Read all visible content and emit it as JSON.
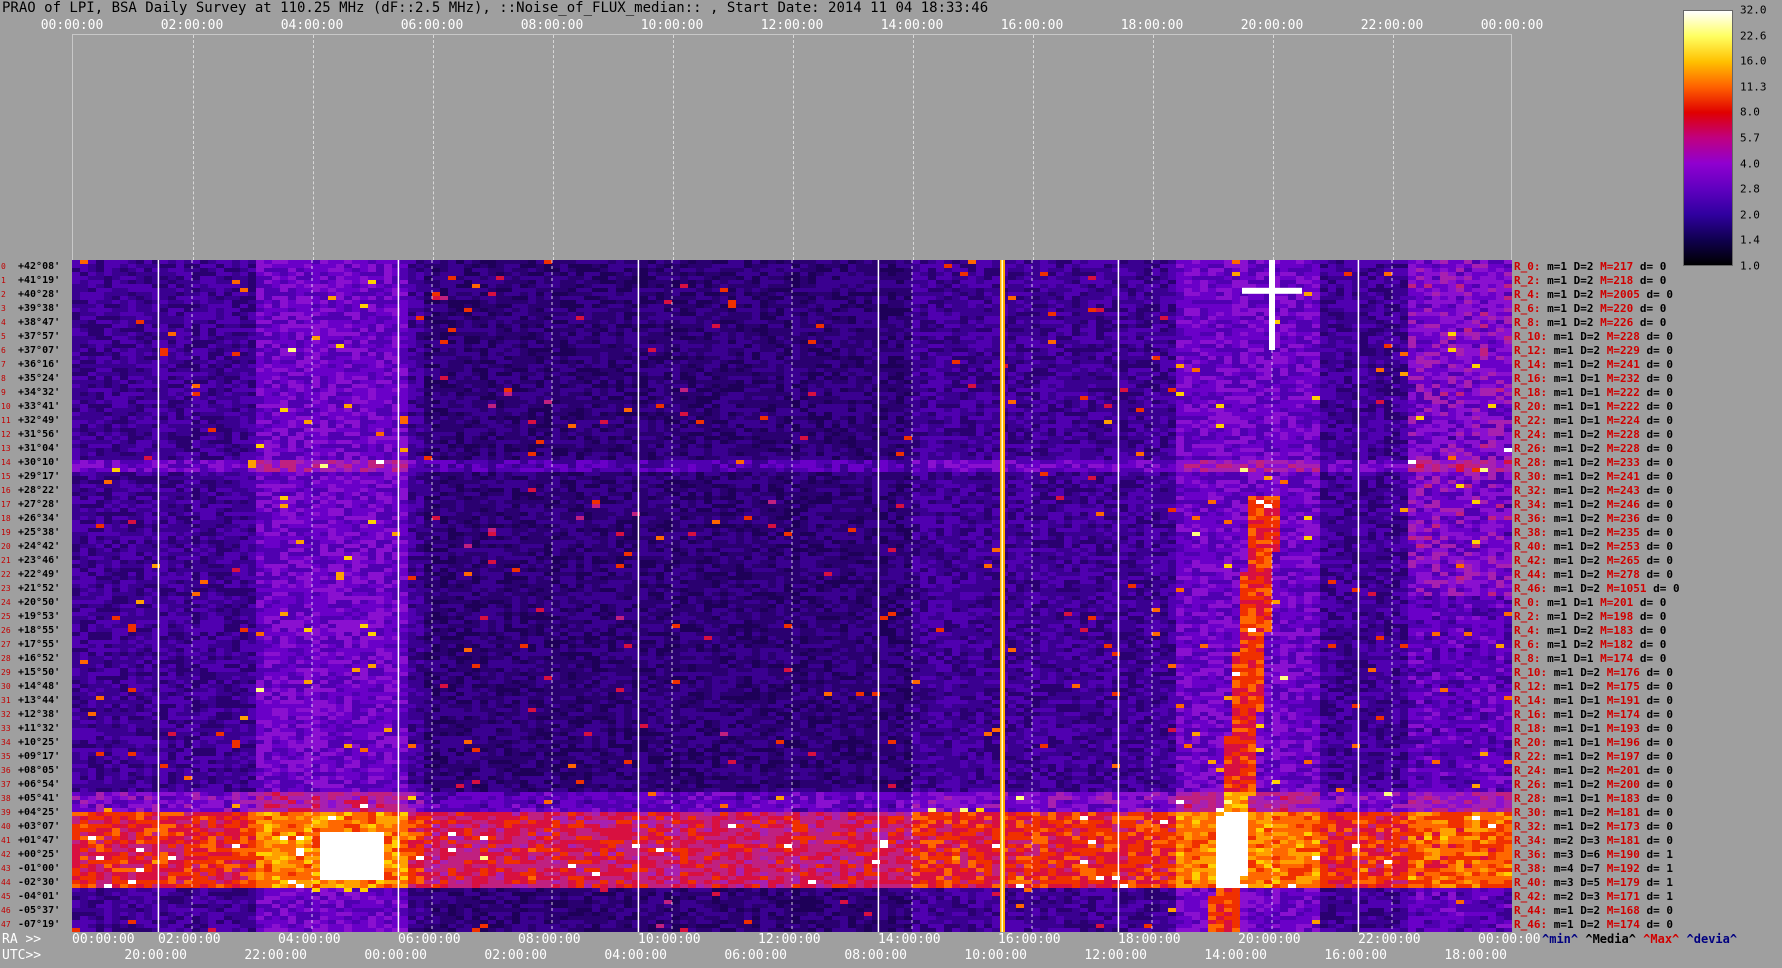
{
  "title": "PRAO of LPI, BSA Daily Survey at 110.25 MHz (dF::2.5 MHz), ::Noise_of_FLUX_median:: , Start Date: 2014 11 04 18:33:46",
  "top_axis_labels": [
    "00:00:00",
    "02:00:00",
    "04:00:00",
    "06:00:00",
    "08:00:00",
    "10:00:00",
    "12:00:00",
    "14:00:00",
    "16:00:00",
    "18:00:00",
    "20:00:00",
    "22:00:00",
    "00:00:00"
  ],
  "bottom": {
    "ra_prefix": "RA >>",
    "utc_prefix": "UTC>>",
    "ra_labels": [
      "00:00:00",
      "02:00:00",
      "04:00:00",
      "06:00:00",
      "08:00:00",
      "10:00:00",
      "12:00:00",
      "14:00:00",
      "16:00:00",
      "18:00:00",
      "20:00:00",
      "22:00:00",
      "00:00:00"
    ],
    "utc_labels": [
      "20:00:00",
      "22:00:00",
      "00:00:00",
      "02:00:00",
      "04:00:00",
      "06:00:00",
      "08:00:00",
      "10:00:00",
      "12:00:00",
      "14:00:00",
      "16:00:00",
      "18:00:00"
    ],
    "legend_keys": [
      {
        "text": "^min^",
        "color": "#000080"
      },
      {
        "text": "^Media^",
        "color": "#000000"
      },
      {
        "text": "^Max^",
        "color": "#d00000"
      },
      {
        "text": "^devia^",
        "color": "#000080"
      }
    ]
  },
  "colorbar": {
    "labels": [
      "32.0",
      "22.6",
      "16.0",
      "11.3",
      "8.0",
      "5.7",
      "4.0",
      "2.8",
      "2.0",
      "1.4",
      "1.0"
    ],
    "colors": [
      "#ffffff",
      "#ffff60",
      "#ffc000",
      "#ff6000",
      "#e00000",
      "#c00080",
      "#9000d0",
      "#6000c0",
      "#3000a0",
      "#100050",
      "#000000"
    ]
  },
  "declinations": [
    "+42°08'",
    "+41°19'",
    "+40°28'",
    "+39°38'",
    "+38°47'",
    "+37°57'",
    "+37°07'",
    "+36°16'",
    "+35°24'",
    "+34°32'",
    "+33°41'",
    "+32°49'",
    "+31°56'",
    "+31°04'",
    "+30°10'",
    "+29°17'",
    "+28°22'",
    "+27°28'",
    "+26°34'",
    "+25°38'",
    "+24°42'",
    "+23°46'",
    "+22°49'",
    "+21°52'",
    "+20°50'",
    "+19°53'",
    "+18°55'",
    "+17°55'",
    "+16°52'",
    "+15°50'",
    "+14°48'",
    "+13°44'",
    "+12°38'",
    "+11°32'",
    "+10°25'",
    "+09°17'",
    "+08°05'",
    "+06°54'",
    "+05°41'",
    "+04°25'",
    "+03°07'",
    "+01°47'",
    "+00°25'",
    "-01°00'",
    "-02°30'",
    "-04°01'",
    "-05°37'",
    "-07°19'"
  ],
  "stats": [
    {
      "r": "R_0:",
      "m": "m=1",
      "d": "D=2",
      "M": "M=217",
      "dev": "d= 0"
    },
    {
      "r": "R_2:",
      "m": "m=1",
      "d": "D=2",
      "M": "M=218",
      "dev": "d= 0"
    },
    {
      "r": "R_4:",
      "m": "m=1",
      "d": "D=2",
      "M": "M=2005",
      "dev": "d= 0"
    },
    {
      "r": "R_6:",
      "m": "m=1",
      "d": "D=2",
      "M": "M=220",
      "dev": "d= 0"
    },
    {
      "r": "R_8:",
      "m": "m=1",
      "d": "D=2",
      "M": "M=226",
      "dev": "d= 0"
    },
    {
      "r": "R_10:",
      "m": "m=1",
      "d": "D=2",
      "M": "M=228",
      "dev": "d= 0"
    },
    {
      "r": "R_12:",
      "m": "m=1",
      "d": "D=2",
      "M": "M=229",
      "dev": "d= 0"
    },
    {
      "r": "R_14:",
      "m": "m=1",
      "d": "D=2",
      "M": "M=241",
      "dev": "d= 0"
    },
    {
      "r": "R_16:",
      "m": "m=1",
      "d": "D=1",
      "M": "M=232",
      "dev": "d= 0"
    },
    {
      "r": "R_18:",
      "m": "m=1",
      "d": "D=1",
      "M": "M=222",
      "dev": "d= 0"
    },
    {
      "r": "R_20:",
      "m": "m=1",
      "d": "D=1",
      "M": "M=222",
      "dev": "d= 0"
    },
    {
      "r": "R_22:",
      "m": "m=1",
      "d": "D=1",
      "M": "M=224",
      "dev": "d= 0"
    },
    {
      "r": "R_24:",
      "m": "m=1",
      "d": "D=2",
      "M": "M=228",
      "dev": "d= 0"
    },
    {
      "r": "R_26:",
      "m": "m=1",
      "d": "D=2",
      "M": "M=228",
      "dev": "d= 0"
    },
    {
      "r": "R_28:",
      "m": "m=1",
      "d": "D=2",
      "M": "M=233",
      "dev": "d= 0"
    },
    {
      "r": "R_30:",
      "m": "m=1",
      "d": "D=2",
      "M": "M=241",
      "dev": "d= 0"
    },
    {
      "r": "R_32:",
      "m": "m=1",
      "d": "D=2",
      "M": "M=243",
      "dev": "d= 0"
    },
    {
      "r": "R_34:",
      "m": "m=1",
      "d": "D=2",
      "M": "M=246",
      "dev": "d= 0"
    },
    {
      "r": "R_36:",
      "m": "m=1",
      "d": "D=2",
      "M": "M=236",
      "dev": "d= 0"
    },
    {
      "r": "R_38:",
      "m": "m=1",
      "d": "D=2",
      "M": "M=235",
      "dev": "d= 0"
    },
    {
      "r": "R_40:",
      "m": "m=1",
      "d": "D=2",
      "M": "M=253",
      "dev": "d= 0"
    },
    {
      "r": "R_42:",
      "m": "m=1",
      "d": "D=2",
      "M": "M=265",
      "dev": "d= 0"
    },
    {
      "r": "R_44:",
      "m": "m=1",
      "d": "D=2",
      "M": "M=278",
      "dev": "d= 0"
    },
    {
      "r": "R_46:",
      "m": "m=1",
      "d": "D=2",
      "M": "M=1051",
      "dev": "d= 0"
    },
    {
      "r": "R_0:",
      "m": "m=1",
      "d": "D=1",
      "M": "M=201",
      "dev": "d= 0"
    },
    {
      "r": "R_2:",
      "m": "m=1",
      "d": "D=2",
      "M": "M=198",
      "dev": "d= 0"
    },
    {
      "r": "R_4:",
      "m": "m=1",
      "d": "D=2",
      "M": "M=183",
      "dev": "d= 0"
    },
    {
      "r": "R_6:",
      "m": "m=1",
      "d": "D=2",
      "M": "M=182",
      "dev": "d= 0"
    },
    {
      "r": "R_8:",
      "m": "m=1",
      "d": "D=1",
      "M": "M=174",
      "dev": "d= 0"
    },
    {
      "r": "R_10:",
      "m": "m=1",
      "d": "D=2",
      "M": "M=176",
      "dev": "d= 0"
    },
    {
      "r": "R_12:",
      "m": "m=1",
      "d": "D=2",
      "M": "M=175",
      "dev": "d= 0"
    },
    {
      "r": "R_14:",
      "m": "m=1",
      "d": "D=1",
      "M": "M=191",
      "dev": "d= 0"
    },
    {
      "r": "R_16:",
      "m": "m=1",
      "d": "D=2",
      "M": "M=174",
      "dev": "d= 0"
    },
    {
      "r": "R_18:",
      "m": "m=1",
      "d": "D=1",
      "M": "M=193",
      "dev": "d= 0"
    },
    {
      "r": "R_20:",
      "m": "m=1",
      "d": "D=1",
      "M": "M=196",
      "dev": "d= 0"
    },
    {
      "r": "R_22:",
      "m": "m=1",
      "d": "D=2",
      "M": "M=197",
      "dev": "d= 0"
    },
    {
      "r": "R_24:",
      "m": "m=1",
      "d": "D=2",
      "M": "M=201",
      "dev": "d= 0"
    },
    {
      "r": "R_26:",
      "m": "m=1",
      "d": "D=2",
      "M": "M=200",
      "dev": "d= 0"
    },
    {
      "r": "R_28:",
      "m": "m=1",
      "d": "D=1",
      "M": "M=183",
      "dev": "d= 0"
    },
    {
      "r": "R_30:",
      "m": "m=1",
      "d": "D=2",
      "M": "M=181",
      "dev": "d= 0"
    },
    {
      "r": "R_32:",
      "m": "m=1",
      "d": "D=2",
      "M": "M=173",
      "dev": "d= 0"
    },
    {
      "r": "R_34:",
      "m": "m=2",
      "d": "D=3",
      "M": "M=181",
      "dev": "d= 0"
    },
    {
      "r": "R_36:",
      "m": "m=3",
      "d": "D=6",
      "M": "M=190",
      "dev": "d= 1"
    },
    {
      "r": "R_38:",
      "m": "m=4",
      "d": "D=7",
      "M": "M=192",
      "dev": "d= 1"
    },
    {
      "r": "R_40:",
      "m": "m=3",
      "d": "D=5",
      "M": "M=179",
      "dev": "d= 1"
    },
    {
      "r": "R_42:",
      "m": "m=2",
      "d": "D=3",
      "M": "M=171",
      "dev": "d= 1"
    },
    {
      "r": "R_44:",
      "m": "m=1",
      "d": "D=2",
      "M": "M=168",
      "dev": "d= 0"
    },
    {
      "r": "R_46:",
      "m": "m=1",
      "d": "D=2",
      "M": "M=174",
      "dev": "d= 0"
    }
  ],
  "chart_data": {
    "type": "heatmap",
    "title": "PRAO of LPI, BSA Daily Survey at 110.25 MHz (dF::2.5 MHz), ::Noise_of_FLUX_median:: , Start Date: 2014 11 04 18:33:46",
    "x_axis_top": "RA 00:00:00 – 24:00:00",
    "x_axis_bottom": {
      "ra_start": "00:00:00",
      "utc_start": "18:33:46"
    },
    "y_labels": "declinations (48 rows, +42°08' to -07°19')",
    "colorscale_range": [
      1.0,
      32.0
    ],
    "colorscale_log": true,
    "features": [
      {
        "kind": "bright band",
        "dec_range": [
          "+00°25'",
          "-02°30'"
        ],
        "ra_range": [
          "00:00",
          "24:00"
        ],
        "level": "high"
      },
      {
        "kind": "bright column",
        "ra": "15:30",
        "level": "high"
      },
      {
        "kind": "diagonal track",
        "ra_range": [
          "19:10",
          "20:30"
        ],
        "dec_range": [
          "-07°19'",
          "+42°08'"
        ],
        "level": "medium"
      },
      {
        "kind": "bright source",
        "ra": "20:00",
        "dec": "+40°28'",
        "level": "max"
      },
      {
        "kind": "hot spot",
        "ra": "04:40",
        "dec": "-01°00'",
        "level": "max"
      },
      {
        "kind": "horizontal line",
        "dec": "+30°10'",
        "level": "medium"
      }
    ]
  }
}
